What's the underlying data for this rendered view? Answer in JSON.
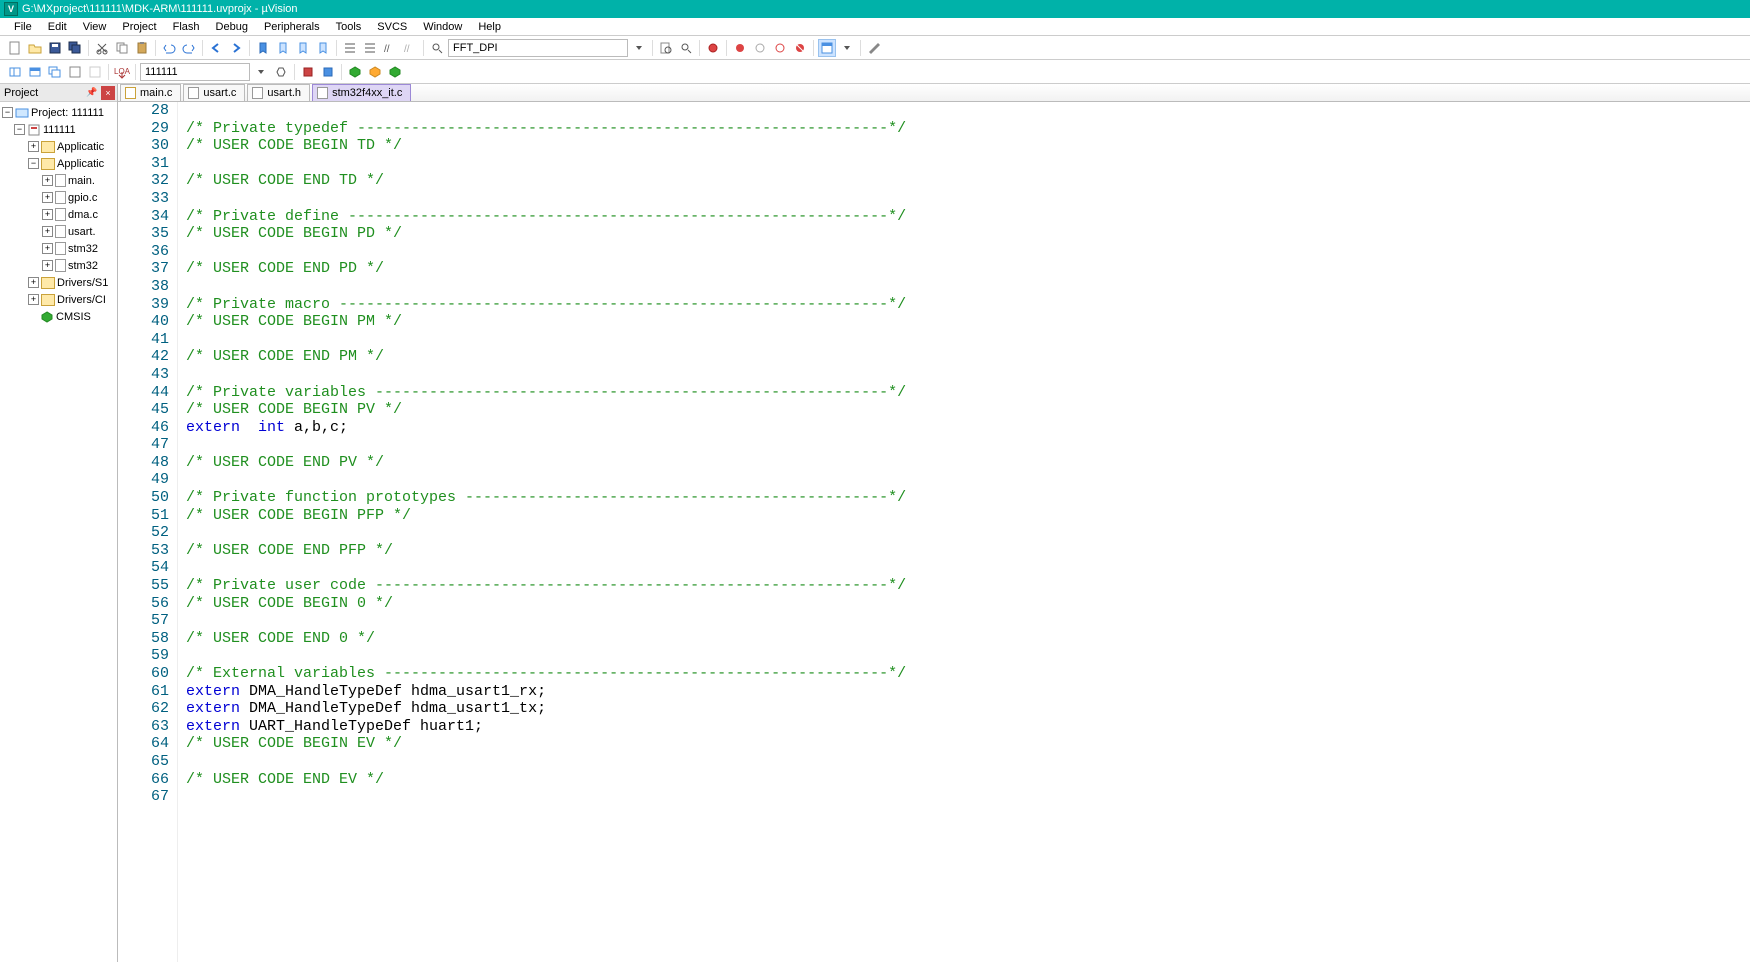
{
  "window": {
    "title": "G:\\MXproject\\111111\\MDK-ARM\\111111.uvprojx - µVision"
  },
  "menu": [
    "File",
    "Edit",
    "View",
    "Project",
    "Flash",
    "Debug",
    "Peripherals",
    "Tools",
    "SVCS",
    "Window",
    "Help"
  ],
  "toolbar1": {
    "combo1": "FFT_DPI"
  },
  "toolbar2": {
    "target": "111111"
  },
  "project": {
    "title": "Project",
    "nodes": {
      "root": "Project: 111111",
      "target": "111111",
      "grp1": "Applicatic",
      "grp2": "Applicatic",
      "files": [
        "main.",
        "gpio.c",
        "dma.c",
        "usart.",
        "stm32",
        "stm32"
      ],
      "drv1": "Drivers/S1",
      "drv2": "Drivers/CI",
      "cmsis": "CMSIS"
    }
  },
  "tabs": [
    {
      "label": "main.c",
      "cls": "yellow"
    },
    {
      "label": "usart.c",
      "cls": ""
    },
    {
      "label": "usart.h",
      "cls": ""
    },
    {
      "label": "stm32f4xx_it.c",
      "cls": "active"
    }
  ],
  "code": {
    "first_line": 28,
    "lines": [
      [],
      [
        [
          "comment",
          "/* Private typedef -----------------------------------------------------------*/"
        ]
      ],
      [
        [
          "comment",
          "/* USER CODE BEGIN TD */"
        ]
      ],
      [],
      [
        [
          "comment",
          "/* USER CODE END TD */"
        ]
      ],
      [],
      [
        [
          "comment",
          "/* Private define ------------------------------------------------------------*/"
        ]
      ],
      [
        [
          "comment",
          "/* USER CODE BEGIN PD */"
        ]
      ],
      [],
      [
        [
          "comment",
          "/* USER CODE END PD */"
        ]
      ],
      [],
      [
        [
          "comment",
          "/* Private macro -------------------------------------------------------------*/"
        ]
      ],
      [
        [
          "comment",
          "/* USER CODE BEGIN PM */"
        ]
      ],
      [],
      [
        [
          "comment",
          "/* USER CODE END PM */"
        ]
      ],
      [],
      [
        [
          "comment",
          "/* Private variables ---------------------------------------------------------*/"
        ]
      ],
      [
        [
          "comment",
          "/* USER CODE BEGIN PV */"
        ]
      ],
      [
        [
          "keyword",
          "extern"
        ],
        [
          "normal",
          "  "
        ],
        [
          "keyword",
          "int"
        ],
        [
          "normal",
          " a,b,c;"
        ]
      ],
      [],
      [
        [
          "comment",
          "/* USER CODE END PV */"
        ]
      ],
      [],
      [
        [
          "comment",
          "/* Private function prototypes -----------------------------------------------*/"
        ]
      ],
      [
        [
          "comment",
          "/* USER CODE BEGIN PFP */"
        ]
      ],
      [],
      [
        [
          "comment",
          "/* USER CODE END PFP */"
        ]
      ],
      [],
      [
        [
          "comment",
          "/* Private user code ---------------------------------------------------------*/"
        ]
      ],
      [
        [
          "comment",
          "/* USER CODE BEGIN 0 */"
        ]
      ],
      [],
      [
        [
          "comment",
          "/* USER CODE END 0 */"
        ]
      ],
      [],
      [
        [
          "comment",
          "/* External variables --------------------------------------------------------*/"
        ]
      ],
      [
        [
          "keyword",
          "extern"
        ],
        [
          "normal",
          " DMA_HandleTypeDef hdma_usart1_rx;"
        ]
      ],
      [
        [
          "keyword",
          "extern"
        ],
        [
          "normal",
          " DMA_HandleTypeDef hdma_usart1_tx;"
        ]
      ],
      [
        [
          "keyword",
          "extern"
        ],
        [
          "normal",
          " UART_HandleTypeDef huart1;"
        ]
      ],
      [
        [
          "comment",
          "/* USER CODE BEGIN EV */"
        ]
      ],
      [],
      [
        [
          "comment",
          "/* USER CODE END EV */"
        ]
      ],
      []
    ]
  }
}
